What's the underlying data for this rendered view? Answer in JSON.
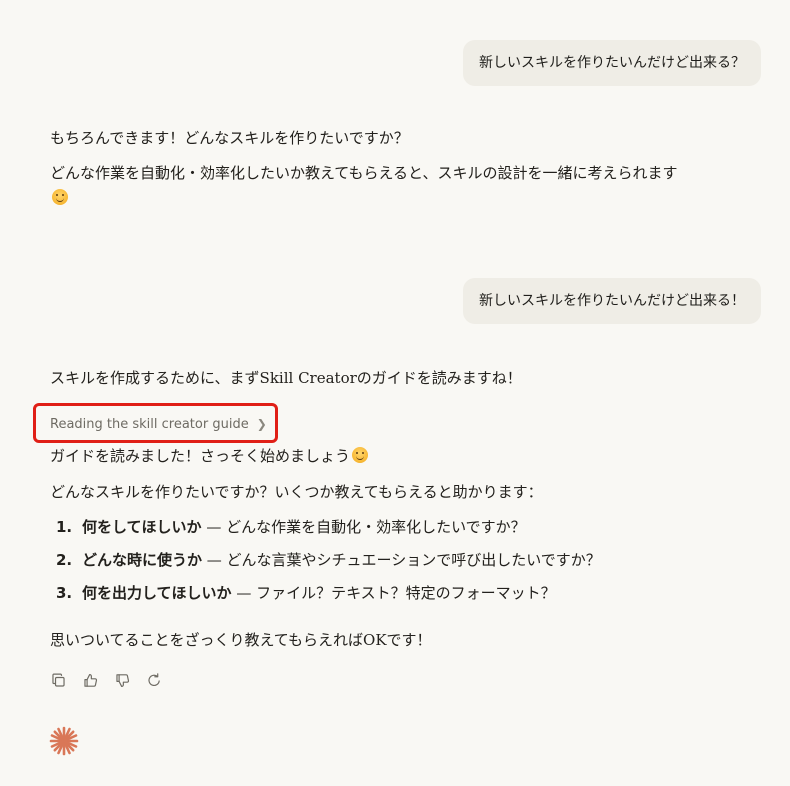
{
  "conversation": {
    "user_message_1": "新しいスキルを作りたいんだけど出来る？",
    "assistant_1": {
      "line_1": "もちろんできます！どんなスキルを作りたいですか？",
      "line_2": "どんな作業を自動化・効率化したいか教えてもらえると、スキルの設計を一緒に考えられます"
    },
    "user_message_2": "新しいスキルを作りたいんだけど出来る！",
    "assistant_2": {
      "intro": "スキルを作成するために、まずSkill Creatorのガイドを読みますね！",
      "tool_call_label": "Reading the skill creator guide",
      "after_tool": "ガイドを読みました！さっそく始めましょう",
      "question": "どんなスキルを作りたいですか？いくつか教えてもらえると助かります：",
      "items": [
        {
          "num": "1.",
          "title": "何をしてほしいか",
          "detail": " — どんな作業を自動化・効率化したいですか？"
        },
        {
          "num": "2.",
          "title": "どんな時に使うか",
          "detail": " — どんな言葉やシチュエーションで呼び出したいですか？"
        },
        {
          "num": "3.",
          "title": "何を出力してほしいか",
          "detail": " — ファイル？テキスト？特定のフォーマット？"
        }
      ],
      "closing": "思いついてることをざっくり教えてもらえればOKです！"
    }
  },
  "message_actions": {
    "icons": [
      "copy-icon",
      "thumbs-up-icon",
      "thumbs-down-icon",
      "retry-icon"
    ]
  },
  "colors": {
    "background": "#f9f8f4",
    "user_bubble": "#efede6",
    "highlight_border": "#e01f16",
    "brand_spark": "#d97757"
  }
}
